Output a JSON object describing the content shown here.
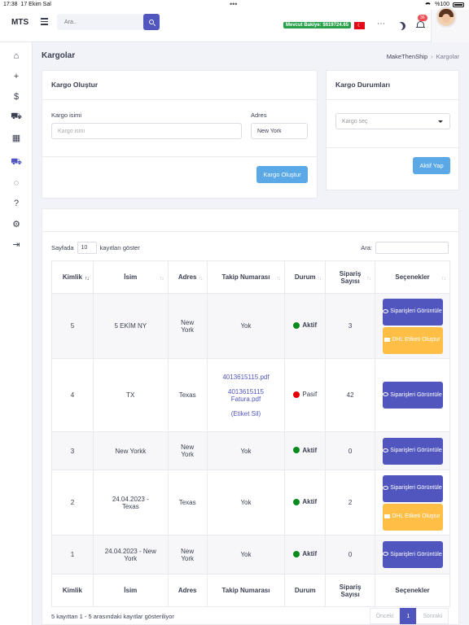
{
  "statusbar": {
    "time": "17:38",
    "date": "17 Ekim Sal",
    "battery": "%100"
  },
  "header": {
    "brand": "MTS",
    "search_placeholder": "Ara..",
    "balance": "Mevcut Bakiye: $619724.65",
    "flag": "TR",
    "notifications": "36"
  },
  "sidebar": {
    "icons": [
      "home-icon",
      "plus-icon",
      "dollar-icon",
      "cart-icon",
      "store-icon",
      "truck-icon",
      "chat-icon",
      "help-icon",
      "settings-icon",
      "logout-icon"
    ]
  },
  "page": {
    "title": "Kargolar",
    "breadcrumb": [
      "MakeThenShip",
      "Kargolar"
    ]
  },
  "create_card": {
    "title": "Kargo Oluştur",
    "name_label": "Kargo isimi",
    "name_placeholder": "Kargo ismi",
    "address_label": "Adres",
    "address_value": "New York",
    "submit": "Kargo Oluştur"
  },
  "status_card": {
    "title": "Kargo Durumları",
    "select_placeholder": "Kargo seç",
    "submit": "Aktif Yap"
  },
  "table": {
    "length_prefix": "Sayfada",
    "length_value": "10",
    "length_suffix": "kayıtları göster",
    "filter_label": "Ara:",
    "columns": [
      "Kimlik",
      "İsim",
      "Adres",
      "Takip Numarası",
      "Durum",
      "Sipariş Sayısı",
      "Seçenekler"
    ],
    "rows": [
      {
        "id": "5",
        "name": "5 EKİM NY",
        "address": "New York",
        "tracking": "Yok",
        "status": "Aktif",
        "orders": "3",
        "view": "Siparişleri Görüntüle",
        "dhl": "DHL Etiketi Oluştur"
      },
      {
        "id": "4",
        "name": "TX",
        "address": "Texas",
        "tracking_links": [
          "4013615115.pdf",
          "4013615115 Fatura.pdf",
          "(Etiket Sil)"
        ],
        "status": "Pasif",
        "orders": "42",
        "view": "Siparişleri Görüntüle"
      },
      {
        "id": "3",
        "name": "New Yorkk",
        "address": "New York",
        "tracking": "Yok",
        "status": "Aktif",
        "orders": "0",
        "view": "Siparişleri Görüntüle"
      },
      {
        "id": "2",
        "name": "24.04.2023 - Texas",
        "address": "Texas",
        "tracking": "Yok",
        "status": "Aktif",
        "orders": "2",
        "view": "Siparişleri Görüntüle",
        "dhl": "DHL Etiketi Oluştur"
      },
      {
        "id": "1",
        "name": "24.04.2023 - New York",
        "address": "New York",
        "tracking": "Yok",
        "status": "Aktif",
        "orders": "0",
        "view": "Siparişleri Görüntüle"
      }
    ],
    "info": "5 kayıttan 1 - 5 arasındaki kayıtlar gösteriliyor",
    "pagination": {
      "prev": "Önceki",
      "current": "1",
      "next": "Sonraki"
    }
  }
}
